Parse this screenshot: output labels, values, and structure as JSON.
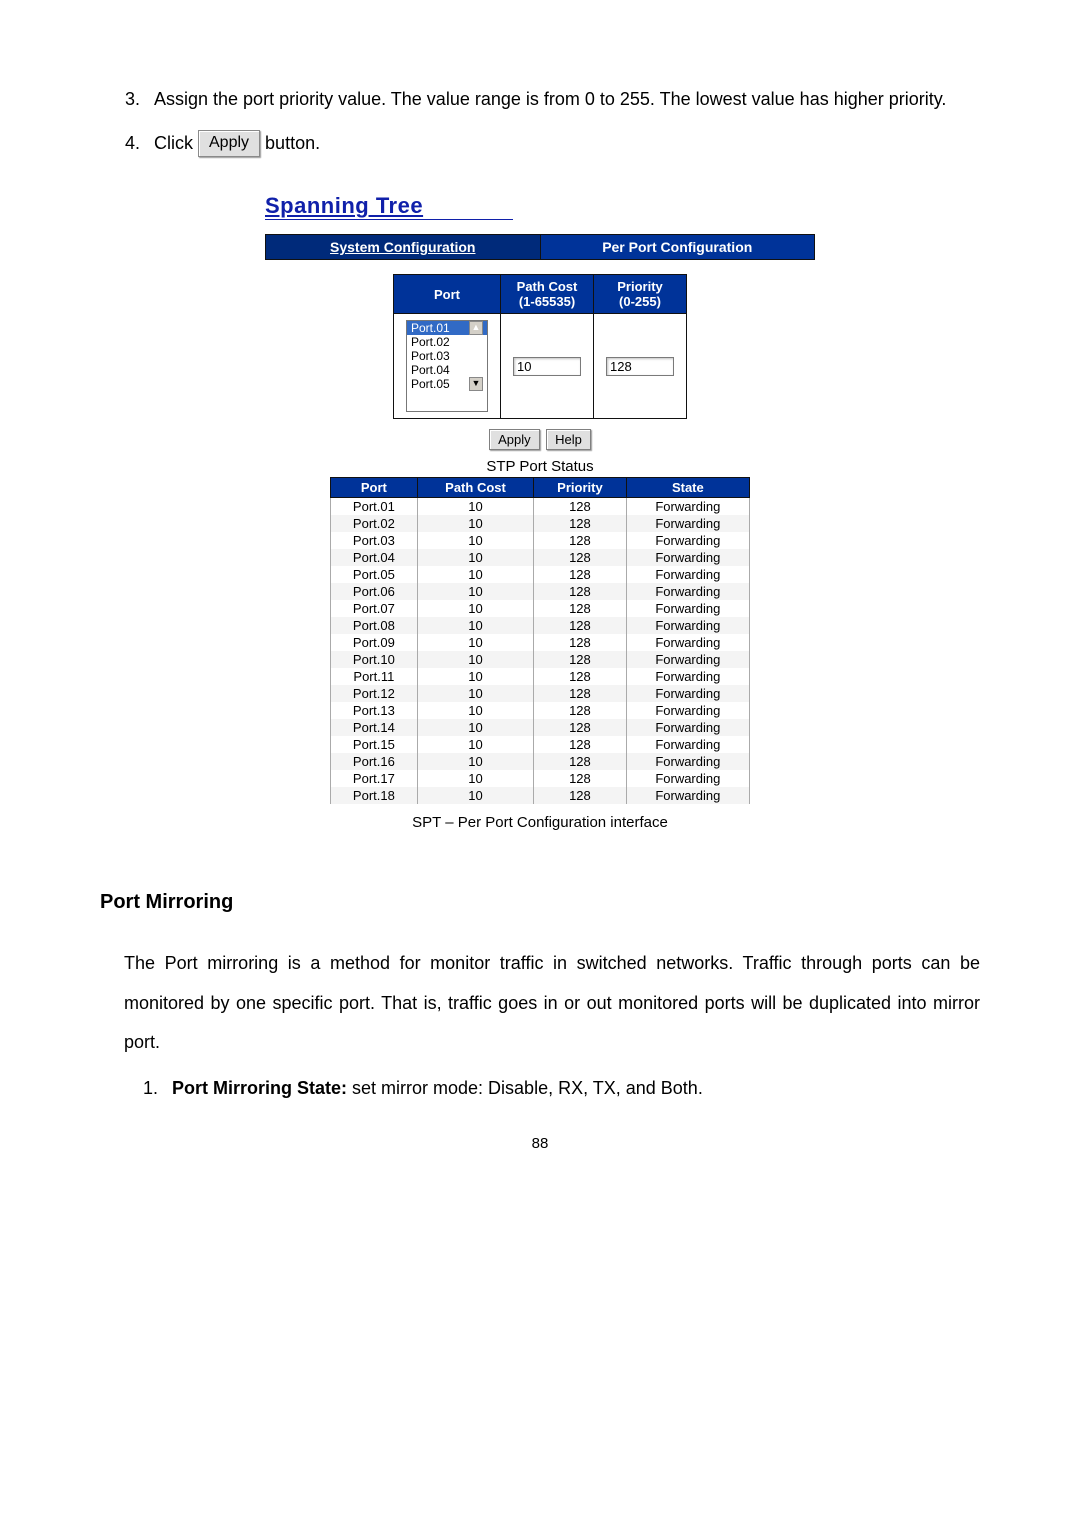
{
  "steps": {
    "s3_marker": "3.",
    "s3_text": "Assign the port priority value. The value range is from 0 to 255. The lowest value has higher priority.",
    "s4_marker": "4.",
    "s4_pre": "Click ",
    "s4_apply": "Apply",
    "s4_post": " button."
  },
  "panel": {
    "title": "Spanning Tree",
    "tabs": {
      "left": "System Configuration",
      "right": "Per Port Configuration"
    },
    "cfg": {
      "hdr_port": "Port",
      "hdr_cost": "Path Cost\n(1-65535)",
      "hdr_prio": "Priority\n(0-255)",
      "ports": [
        "Port.01",
        "Port.02",
        "Port.03",
        "Port.04",
        "Port.05"
      ],
      "cost_value": "10",
      "prio_value": "128"
    },
    "btn_apply": "Apply",
    "btn_help": "Help",
    "status_title": "STP Port Status",
    "status_hdr": {
      "port": "Port",
      "cost": "Path Cost",
      "prio": "Priority",
      "state": "State"
    },
    "status_rows": [
      {
        "port": "Port.01",
        "cost": "10",
        "prio": "128",
        "state": "Forwarding"
      },
      {
        "port": "Port.02",
        "cost": "10",
        "prio": "128",
        "state": "Forwarding"
      },
      {
        "port": "Port.03",
        "cost": "10",
        "prio": "128",
        "state": "Forwarding"
      },
      {
        "port": "Port.04",
        "cost": "10",
        "prio": "128",
        "state": "Forwarding"
      },
      {
        "port": "Port.05",
        "cost": "10",
        "prio": "128",
        "state": "Forwarding"
      },
      {
        "port": "Port.06",
        "cost": "10",
        "prio": "128",
        "state": "Forwarding"
      },
      {
        "port": "Port.07",
        "cost": "10",
        "prio": "128",
        "state": "Forwarding"
      },
      {
        "port": "Port.08",
        "cost": "10",
        "prio": "128",
        "state": "Forwarding"
      },
      {
        "port": "Port.09",
        "cost": "10",
        "prio": "128",
        "state": "Forwarding"
      },
      {
        "port": "Port.10",
        "cost": "10",
        "prio": "128",
        "state": "Forwarding"
      },
      {
        "port": "Port.11",
        "cost": "10",
        "prio": "128",
        "state": "Forwarding"
      },
      {
        "port": "Port.12",
        "cost": "10",
        "prio": "128",
        "state": "Forwarding"
      },
      {
        "port": "Port.13",
        "cost": "10",
        "prio": "128",
        "state": "Forwarding"
      },
      {
        "port": "Port.14",
        "cost": "10",
        "prio": "128",
        "state": "Forwarding"
      },
      {
        "port": "Port.15",
        "cost": "10",
        "prio": "128",
        "state": "Forwarding"
      },
      {
        "port": "Port.16",
        "cost": "10",
        "prio": "128",
        "state": "Forwarding"
      },
      {
        "port": "Port.17",
        "cost": "10",
        "prio": "128",
        "state": "Forwarding"
      },
      {
        "port": "Port.18",
        "cost": "10",
        "prio": "128",
        "state": "Forwarding"
      }
    ]
  },
  "caption": "SPT – Per Port Configuration interface",
  "section": {
    "title": "Port Mirroring",
    "para": "The Port mirroring is a method for monitor traffic in switched networks. Traffic through ports can be monitored by one specific port. That is, traffic goes in or out monitored ports will be duplicated into mirror port.",
    "li1_marker": "1.",
    "li1_bold": "Port Mirroring State:",
    "li1_rest": " set mirror mode: Disable, RX, TX, and Both."
  },
  "page_number": "88"
}
